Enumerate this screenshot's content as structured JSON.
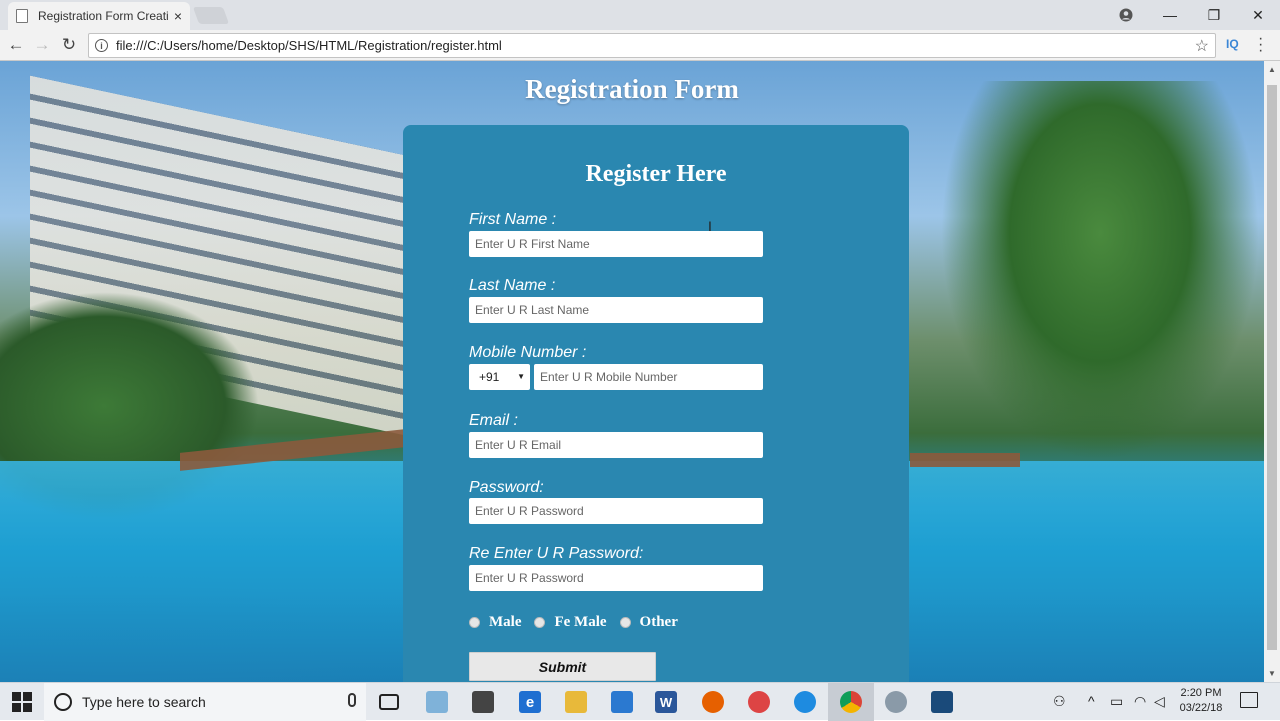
{
  "browser": {
    "tab_title": "Registration Form Creati",
    "tab_close": "×",
    "url": "file:///C:/Users/home/Desktop/SHS/HTML/Registration/register.html",
    "ext_label": "IQ",
    "window_controls": {
      "minimize": "—",
      "restore": "❐",
      "close": "✕"
    }
  },
  "page": {
    "title": "Registration Form",
    "form": {
      "heading": "Register Here",
      "first_name": {
        "label": "First Name :",
        "placeholder": "Enter U R First Name"
      },
      "last_name": {
        "label": "Last Name :",
        "placeholder": "Enter U R Last Name"
      },
      "mobile": {
        "label": "Mobile Number :",
        "country_code": "+91",
        "placeholder": "Enter U R Mobile Number"
      },
      "email": {
        "label": "Email :",
        "placeholder": "Enter U R Email"
      },
      "password": {
        "label": "Password:",
        "placeholder": "Enter U R Password"
      },
      "reenter": {
        "label": "Re Enter U R Password:",
        "placeholder": "Enter U R Password"
      },
      "gender": [
        "Male",
        "Fe Male",
        "Other"
      ],
      "submit": "Submit"
    }
  },
  "taskbar": {
    "search_placeholder": "Type here to search",
    "time": "2:20 PM",
    "date": "03/22/18"
  },
  "colors": {
    "form_bg": "#2a87b0",
    "tabbar": "#dee1e6",
    "taskbar": "#e5e9ee"
  }
}
